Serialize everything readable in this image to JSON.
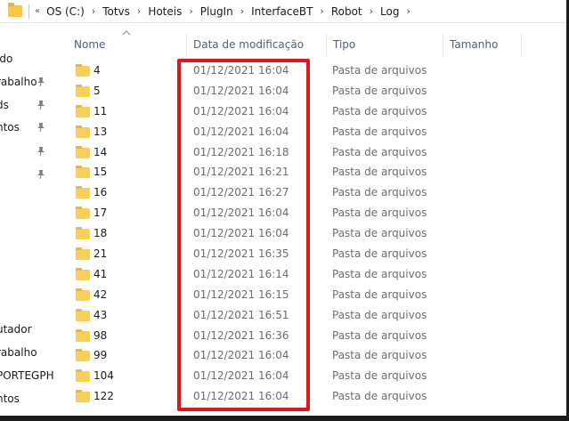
{
  "address_bar": {
    "overflow_glyph": "«",
    "breadcrumbs": [
      "OS (C:)",
      "Totvs",
      "Hoteis",
      "PlugIn",
      "InterfaceBT",
      "Robot",
      "Log"
    ],
    "separator": "›"
  },
  "nav": {
    "items": [
      {
        "label": "ido",
        "pinned": false
      },
      {
        "label": "rabalho",
        "pinned": true
      },
      {
        "label": "ds",
        "pinned": true
      },
      {
        "label": "ntos",
        "pinned": true
      },
      {
        "label": "",
        "pinned": true
      },
      {
        "label": "",
        "pinned": true
      },
      {
        "label": "utador",
        "pinned": false
      },
      {
        "label": "rabalho",
        "pinned": false
      },
      {
        "label": "PORTEGPH",
        "pinned": false
      },
      {
        "label": "ntos",
        "pinned": false
      }
    ]
  },
  "columns": {
    "name": "Nome",
    "date": "Data de modificação",
    "type": "Tipo",
    "size": "Tamanho"
  },
  "files": [
    {
      "name": "4",
      "date": "01/12/2021 16:04",
      "type": "Pasta de arquivos"
    },
    {
      "name": "5",
      "date": "01/12/2021 16:04",
      "type": "Pasta de arquivos"
    },
    {
      "name": "11",
      "date": "01/12/2021 16:04",
      "type": "Pasta de arquivos"
    },
    {
      "name": "13",
      "date": "01/12/2021 16:04",
      "type": "Pasta de arquivos"
    },
    {
      "name": "14",
      "date": "01/12/2021 16:18",
      "type": "Pasta de arquivos"
    },
    {
      "name": "15",
      "date": "01/12/2021 16:21",
      "type": "Pasta de arquivos"
    },
    {
      "name": "16",
      "date": "01/12/2021 16:27",
      "type": "Pasta de arquivos"
    },
    {
      "name": "17",
      "date": "01/12/2021 16:04",
      "type": "Pasta de arquivos"
    },
    {
      "name": "18",
      "date": "01/12/2021 16:04",
      "type": "Pasta de arquivos"
    },
    {
      "name": "21",
      "date": "01/12/2021 16:35",
      "type": "Pasta de arquivos"
    },
    {
      "name": "41",
      "date": "01/12/2021 16:14",
      "type": "Pasta de arquivos"
    },
    {
      "name": "42",
      "date": "01/12/2021 16:15",
      "type": "Pasta de arquivos"
    },
    {
      "name": "43",
      "date": "01/12/2021 16:51",
      "type": "Pasta de arquivos"
    },
    {
      "name": "98",
      "date": "01/12/2021 16:36",
      "type": "Pasta de arquivos"
    },
    {
      "name": "99",
      "date": "01/12/2021 16:04",
      "type": "Pasta de arquivos"
    },
    {
      "name": "104",
      "date": "01/12/2021 16:04",
      "type": "Pasta de arquivos"
    },
    {
      "name": "122",
      "date": "01/12/2021 16:04",
      "type": "Pasta de arquivos"
    }
  ],
  "colors": {
    "highlight": "#e0161b",
    "folder": "#f8cf5a",
    "header_text": "#4c607a"
  }
}
